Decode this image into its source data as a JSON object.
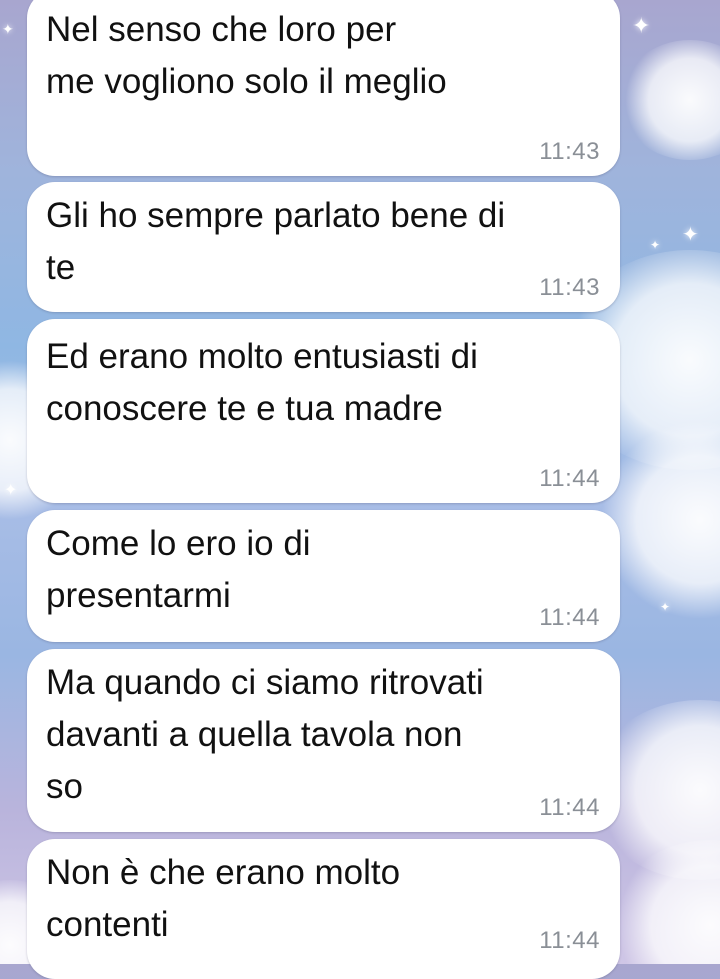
{
  "conversation": {
    "messages": [
      {
        "text": "Nel senso che loro per\nme vogliono solo il meglio",
        "time": "11:43"
      },
      {
        "text": "Gli ho sempre parlato bene di\nte",
        "time": "11:43"
      },
      {
        "text": "Ed erano molto entusiasti di\nconoscere te e tua madre",
        "time": "11:44"
      },
      {
        "text": "Come lo ero io di\npresentarmi",
        "time": "11:44"
      },
      {
        "text": "Ma quando ci siamo ritrovati\ndavanti a quella tavola non\nso",
        "time": "11:44"
      },
      {
        "text": "Non è che erano molto\ncontenti",
        "time": "11:44"
      }
    ]
  },
  "colors": {
    "bubble_background": "#ffffff",
    "message_text": "#111111",
    "timestamp_text": "#8a8f96"
  },
  "background": {
    "icons": [
      "cloud-icon",
      "sparkle-icon"
    ]
  }
}
